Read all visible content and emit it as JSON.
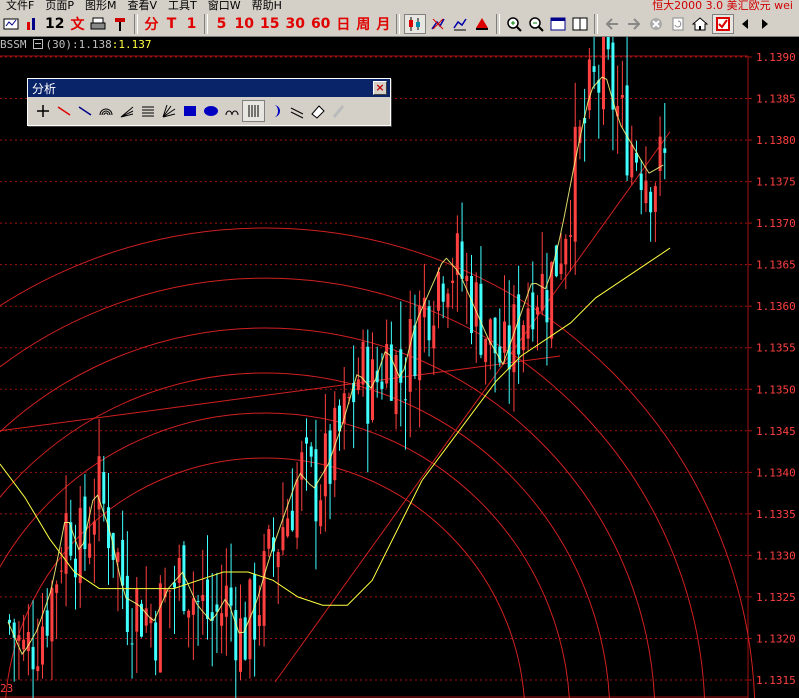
{
  "app": {
    "menus": [
      "文件F",
      "页面P",
      "图形M",
      "查看V",
      "工具T",
      "窗口W",
      "帮助H"
    ],
    "title": "恒大2000 3.0 美汇欧元 wei"
  },
  "toolbar": {
    "period_12": "12",
    "text_btn": "文",
    "min_btn": "分",
    "period_T": "T",
    "period_1": "1",
    "period_5": "5",
    "period_10": "10",
    "period_15": "15",
    "period_30": "30",
    "period_60": "60",
    "day_btn": "日",
    "week_btn": "周",
    "month_btn": "月"
  },
  "indicator": {
    "symbol": "BSSM",
    "period": "(30)",
    "value1": ":1.138",
    "value2": ":1.137"
  },
  "palette": {
    "title": "分析",
    "tools": [
      "crosshair-icon",
      "line-icon",
      "ray-icon",
      "arc-icon",
      "fan-lines-icon",
      "parallel-lines-icon",
      "gann-fan-icon",
      "rectangle-icon",
      "ellipse-icon",
      "cycle-icon",
      "vertical-lines-icon",
      "moon-icon",
      "channel-icon",
      "eraser-icon",
      "pen-icon"
    ]
  },
  "chart_data": {
    "type": "candlestick",
    "y_ticks": [
      "1.1390",
      "1.1385",
      "1.1380",
      "1.1375",
      "1.1370",
      "1.1365",
      "1.1360",
      "1.1355",
      "1.1350",
      "1.1345",
      "1.1340",
      "1.1335",
      "1.1330",
      "1.1325",
      "1.1320",
      "1.1315"
    ],
    "ylim": [
      1.1315,
      1.139
    ],
    "x_label_bottom_left": "23",
    "colors": {
      "up": "#ff4040",
      "down": "#40ffff",
      "ma": "#ffff40",
      "arcs": "#d02020",
      "grid": "#a01010"
    },
    "close_path": [
      1.1322,
      1.1318,
      1.1321,
      1.1326,
      1.1335,
      1.133,
      1.1338,
      1.1333,
      1.1325,
      1.1324,
      1.1322,
      1.1326,
      1.1328,
      1.1324,
      1.1322,
      1.1325,
      1.132,
      1.1324,
      1.133,
      1.1335,
      1.134,
      1.1338,
      1.1341,
      1.1346,
      1.1352,
      1.135,
      1.1355,
      1.1351,
      1.1358,
      1.1362,
      1.1366,
      1.1364,
      1.136,
      1.1356,
      1.1353,
      1.1358,
      1.1363,
      1.1362,
      1.1369,
      1.1378,
      1.1386,
      1.1388,
      1.1382,
      1.1379,
      1.1376,
      1.1377
    ],
    "ma_path": [
      1.1341,
      1.1337,
      1.1332,
      1.1328,
      1.1326,
      1.1326,
      1.1326,
      1.1326,
      1.1327,
      1.1328,
      1.1328,
      1.1327,
      1.1325,
      1.1324,
      1.1324,
      1.1327,
      1.1333,
      1.1339,
      1.1343,
      1.1347,
      1.1351,
      1.1354,
      1.1356,
      1.1358,
      1.1361,
      1.1363,
      1.1365,
      1.1367
    ]
  }
}
